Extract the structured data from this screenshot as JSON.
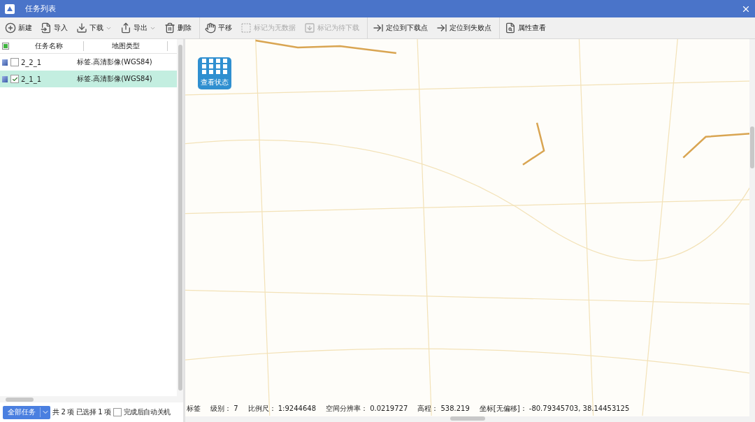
{
  "window": {
    "title": "任务列表"
  },
  "toolbar": [
    [
      {
        "kind": "add",
        "label": "新建",
        "disabled": false,
        "menu": false
      },
      {
        "kind": "import",
        "label": "导入",
        "disabled": false,
        "menu": false
      },
      {
        "kind": "download",
        "label": "下载",
        "disabled": false,
        "menu": true
      },
      {
        "kind": "export",
        "label": "导出",
        "disabled": false,
        "menu": true
      },
      {
        "kind": "delete",
        "label": "删除",
        "disabled": false,
        "menu": false
      }
    ],
    [
      {
        "kind": "pan",
        "label": "平移",
        "disabled": false,
        "menu": false
      },
      {
        "kind": "mark-empty",
        "label": "标记为无数据",
        "disabled": true,
        "menu": false
      },
      {
        "kind": "mark-pending",
        "label": "标记为待下载",
        "disabled": true,
        "menu": false
      }
    ],
    [
      {
        "kind": "locate",
        "label": "定位到下载点",
        "disabled": false,
        "menu": false
      },
      {
        "kind": "locate",
        "label": "定位到失败点",
        "disabled": false,
        "menu": false
      }
    ],
    [
      {
        "kind": "properties",
        "label": "属性查看",
        "disabled": false,
        "menu": false
      }
    ]
  ],
  "task_table": {
    "select_all": {
      "indeterminate": true
    },
    "columns": [
      "任务名称",
      "地图类型"
    ],
    "rows": [
      {
        "name": "2_2_1",
        "map_type": "标签.高清影像(WGS84)",
        "checked": false,
        "selected": false
      },
      {
        "name": "2_1_1",
        "map_type": "标签.高清影像(WGS84)",
        "checked": true,
        "selected": true
      }
    ]
  },
  "footer": {
    "filter_button": "全部任务",
    "total": "共 2 项",
    "selected_count": "已选择 1 项",
    "auto_shutdown": {
      "label": "完成后自动关机",
      "checked": false
    }
  },
  "map": {
    "kind": "picture",
    "status_button": "查看状态",
    "status_bar": [
      {
        "label": "标签"
      },
      {
        "label": "级别：",
        "value": "7"
      },
      {
        "label": "比例尺：",
        "value": "1:9244648"
      },
      {
        "label": "空间分辨率：",
        "value": "0.0219727"
      },
      {
        "label": "高程：",
        "value": "538.219"
      },
      {
        "label": "坐标[无偏移]：",
        "value": "-80.79345703, 38.14453125"
      }
    ]
  }
}
